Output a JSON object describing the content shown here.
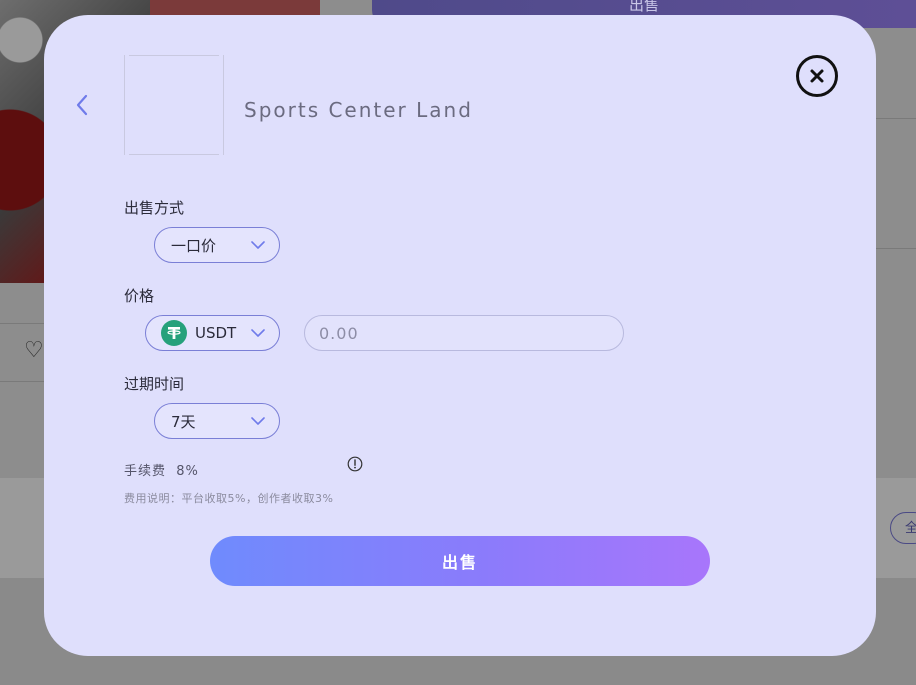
{
  "background": {
    "sell_button_label": "出售",
    "filter_pill_label": "全"
  },
  "modal": {
    "item_title": "Sports Center Land",
    "sale_method": {
      "label": "出售方式",
      "selected": "一口价"
    },
    "price": {
      "label": "价格",
      "currency": "USDT",
      "placeholder": "0.00"
    },
    "expiry": {
      "label": "过期时间",
      "selected": "7天"
    },
    "fee": {
      "text": "手续费  8%",
      "note": "费用说明：平台收取5%，创作者收取3%"
    },
    "submit_label": "出售"
  },
  "colors": {
    "modal_bg": "#dfdffc",
    "accent": "#7a7fd6",
    "button_gradient_start": "#6f8bfd",
    "button_gradient_end": "#a876fb",
    "usdt_green": "#26a17b"
  },
  "icons": [
    "back-chevron-icon",
    "close-icon",
    "chevron-down-icon",
    "usdt-icon",
    "info-icon",
    "heart-icon"
  ]
}
